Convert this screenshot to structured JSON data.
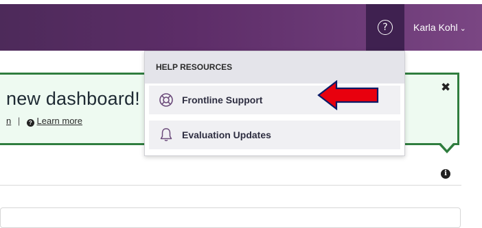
{
  "header": {
    "help_icon": "question-circle-icon",
    "user_name": "Karla Kohl",
    "user_chevron": "⌄"
  },
  "help_menu": {
    "title": "HELP RESOURCES",
    "items": [
      {
        "label": "Frontline Support",
        "icon": "lifebuoy-icon"
      },
      {
        "label": "Evaluation Updates",
        "icon": "bell-icon"
      }
    ]
  },
  "banner": {
    "title": "new dashboard!",
    "link_left": "n",
    "separator": "|",
    "learn_more": "Learn more",
    "close": "✖"
  },
  "section": {
    "info_icon": "i"
  },
  "colors": {
    "topbar": "#5d2d68",
    "help_button_bg": "#3f2150",
    "banner_border": "#2f7d3e",
    "banner_bg": "#eefaf1",
    "arrow_fill": "#e8000e"
  }
}
